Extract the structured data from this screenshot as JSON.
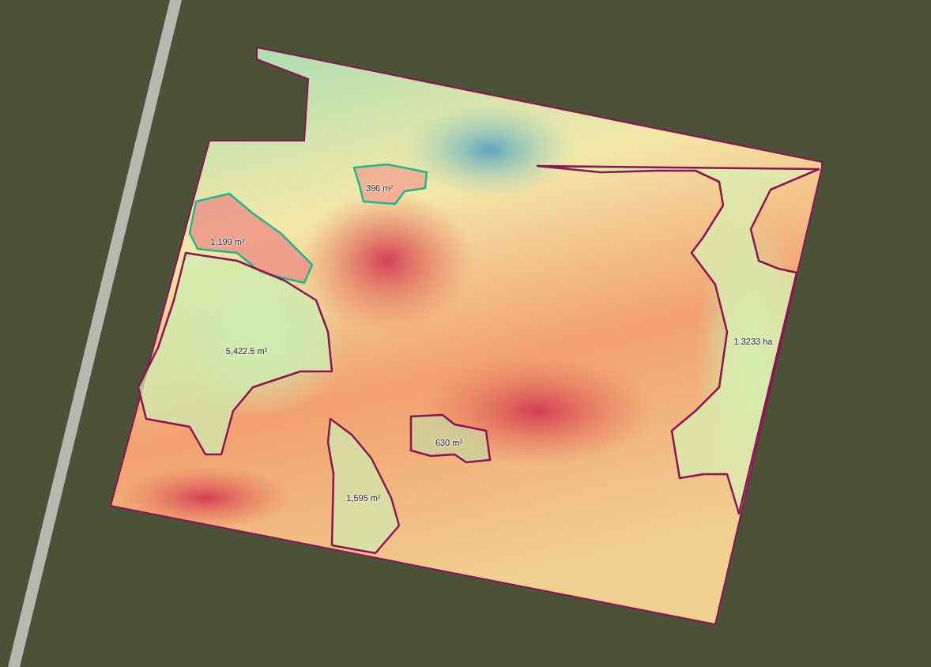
{
  "map": {
    "zones": [
      {
        "label": "396 m²",
        "color": "#1bb88a"
      },
      {
        "label": "1,199 m²",
        "color": "#1bb88a"
      },
      {
        "label": "5,422.5 m²",
        "color": "#8a1454"
      },
      {
        "label": "1.3233 ha",
        "color": "#8a1454"
      },
      {
        "label": "630 m²",
        "color": "#8a1454"
      },
      {
        "label": "1,595 m²",
        "color": "#8a1454"
      }
    ]
  }
}
